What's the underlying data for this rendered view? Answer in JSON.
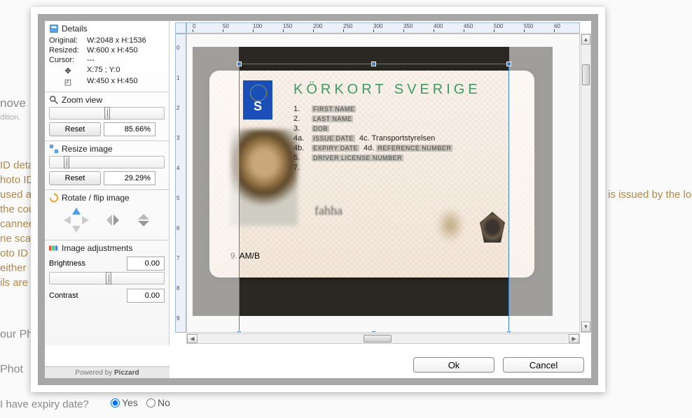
{
  "bg": {
    "remove": "nove",
    "edition": "dition.",
    "l1": "ID deta",
    "l2": "hoto ID",
    "l3": "used a",
    "l4": "the cou",
    "l5": "canned",
    "l6": "ne scan",
    "l7": "oto ID n",
    "l8": "either",
    "l9": "ils are",
    "issued_by": "is issued by the loc",
    "your_ph": "our Ph",
    "photo": "Phot",
    "expiry_q": "I have expiry date?",
    "yes": "Yes",
    "no": "No"
  },
  "details": {
    "title": "Details",
    "original_lbl": "Original:",
    "original_val": "W:2048 x H:1536",
    "resized_lbl": "Resized:",
    "resized_val": "W:600 x H:450",
    "cursor_lbl": "Cursor:",
    "cursor_val": "---",
    "pos_val": "X:75 ; Y:0",
    "crop_val": "W:450 x H:450"
  },
  "zoom": {
    "title": "Zoom view",
    "reset": "Reset",
    "value": "85.66%"
  },
  "resize": {
    "title": "Resize image",
    "reset": "Reset",
    "value": "29.29%"
  },
  "rotate": {
    "title": "Rotate / flip image"
  },
  "adjust": {
    "title": "Image adjustments",
    "brightness": "Brightness",
    "brightness_val": "0.00",
    "contrast": "Contrast",
    "contrast_val": "0.00"
  },
  "powered": {
    "pre": "Powered by ",
    "brand": "Piczard"
  },
  "card": {
    "title": "KÖRKORT SVERIGE",
    "eu_letter": "S",
    "f1": "FIRST NAME",
    "f2": "LAST NAME",
    "f3": "DOB",
    "f4a": "ISSUE DATE",
    "f4c": "Transportstyrelsen",
    "f4b": "EXPIRY DATE",
    "f4d": "REFERENCE NUMBER",
    "f5": "DRIVER LICENSE NUMBER",
    "cat": "9. AM/B",
    "sig": "fahha"
  },
  "ruler_ticks": [
    "0",
    "50",
    "100",
    "150",
    "200",
    "250",
    "300",
    "350",
    "400",
    "450",
    "500",
    "550",
    "60"
  ],
  "footer": {
    "ok": "Ok",
    "cancel": "Cancel"
  }
}
